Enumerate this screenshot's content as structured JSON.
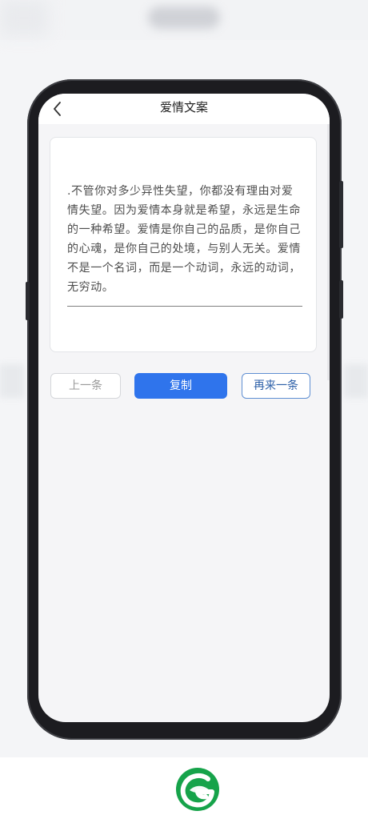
{
  "app": {
    "title": "爱情文案",
    "background": "#f5f5f7",
    "icons": {
      "back": "chevron-left-icon",
      "logo": "leaf-g-logo-icon"
    }
  },
  "content": {
    "quote": ".不管你对多少异性失望，你都没有理由对爱情失望。因为爱情本身就是希望，永远是生命的一种希望。爱情是你自己的品质，是你自己的心魂，是你自己的处境，与别人无关。爱情不是一个名词，而是一个动词，永远的动词，无穷动。"
  },
  "actions": {
    "prev": "上一条",
    "copy": "复制",
    "next": "再来一条"
  },
  "colors": {
    "primary": "#2f74ec",
    "outline_blue": "#5f8fd2",
    "logo_green": "#16a34a"
  }
}
